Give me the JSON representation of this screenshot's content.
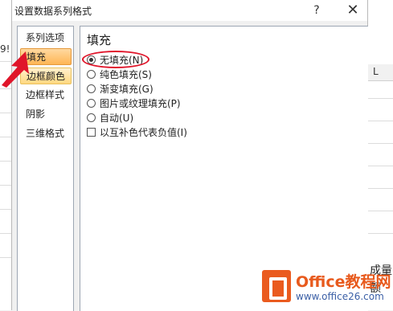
{
  "background": {
    "left_cell_text": "9!",
    "right_header": "L",
    "right_texts": [
      "成量",
      "额"
    ]
  },
  "dialog": {
    "title": "设置数据系列格式",
    "help_label": "?",
    "close_label": "✕"
  },
  "nav": {
    "items": [
      {
        "label": "系列选项"
      },
      {
        "label": "填充"
      },
      {
        "label": "边框颜色"
      },
      {
        "label": "边框样式"
      },
      {
        "label": "阴影"
      },
      {
        "label": "三维格式"
      }
    ],
    "active_index": 1
  },
  "fill": {
    "section_title": "填充",
    "options": [
      {
        "label": "无填充(N)",
        "selected": true
      },
      {
        "label": "纯色填充(S)",
        "selected": false
      },
      {
        "label": "渐变填充(G)",
        "selected": false
      },
      {
        "label": "图片或纹理填充(P)",
        "selected": false
      },
      {
        "label": "自动(U)",
        "selected": false
      }
    ],
    "invert_checkbox": {
      "label": "以互补色代表负值(I)",
      "checked": false
    }
  },
  "watermark": {
    "name": "Office教程网",
    "url": "www.office26.com"
  },
  "colors": {
    "highlight": "#e0152a",
    "brand_orange": "#ea5b1f"
  }
}
